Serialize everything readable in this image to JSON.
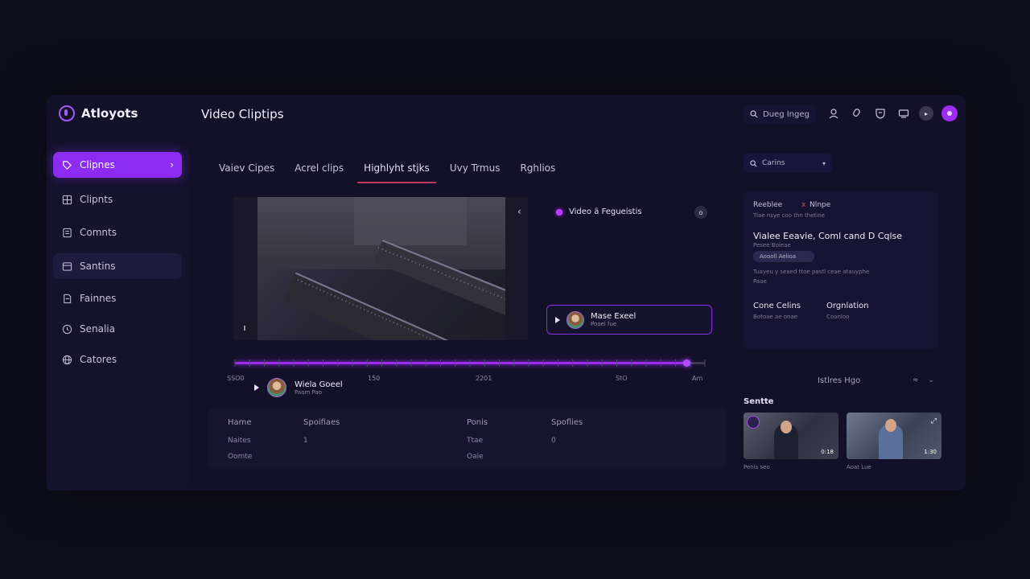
{
  "app": {
    "brand": "Atloyots",
    "page_title": "Video Cliptips"
  },
  "topbar": {
    "search_label": "Dueg Ingeg"
  },
  "sidebar": {
    "items": [
      {
        "label": "Clipnes"
      },
      {
        "label": "Clipnts"
      },
      {
        "label": "Comnts"
      },
      {
        "label": "Santins"
      },
      {
        "label": "Fainnes"
      },
      {
        "label": "Senalia"
      },
      {
        "label": "Catores"
      }
    ]
  },
  "tabs": [
    {
      "label": "Vaiev Cipes"
    },
    {
      "label": "Acrel clips"
    },
    {
      "label": "Highlyht stjks"
    },
    {
      "label": "Uvy Trmus"
    },
    {
      "label": "Rghlios"
    }
  ],
  "video_panel": {
    "title": "Video ä Fegueistis",
    "badge": "o",
    "card_name": "Mase Exeel",
    "card_sub": "Pooel fue"
  },
  "timeline": {
    "progress": 0.96,
    "labels": [
      "SSO0",
      "150",
      "2201",
      "StO",
      "Am"
    ],
    "person_name": "Wiela Goeel",
    "person_sub": "Paom Pao"
  },
  "table": {
    "headers": [
      "Hame",
      "Spoifiaes",
      "Ponis",
      "Spoflies"
    ],
    "rows": [
      [
        "Naites",
        "1",
        "Ttae",
        "0"
      ],
      [
        "Oomte",
        "",
        "Oaie",
        ""
      ]
    ]
  },
  "right": {
    "search": "Carins",
    "card": {
      "tag_left": "Reeblee",
      "tag_x": "x",
      "tag_right": "Nlnpe",
      "tag_sub": "Tiae nsye coo thn thetine",
      "title": "Vialee Eeavie, Coml cand D Cqlse",
      "title_sub": "Pesee Boieae",
      "pill": "Aoooll Aelioa",
      "desc": "Tuayeu y seaed ttoe pastl ceae atauyphe",
      "desc2": "Paae",
      "col1_title": "Cone Celins",
      "col1_sub": "Botoae ae onae",
      "col2_title": "Orgnlation",
      "col2_sub": "Coanloo"
    },
    "filter": "Istlres Hgo",
    "section": "Sentte",
    "thumbs": [
      {
        "duration": "0:18",
        "caption": "Penis seo"
      },
      {
        "duration": "1:30",
        "caption": "Aoat Lue"
      }
    ]
  }
}
